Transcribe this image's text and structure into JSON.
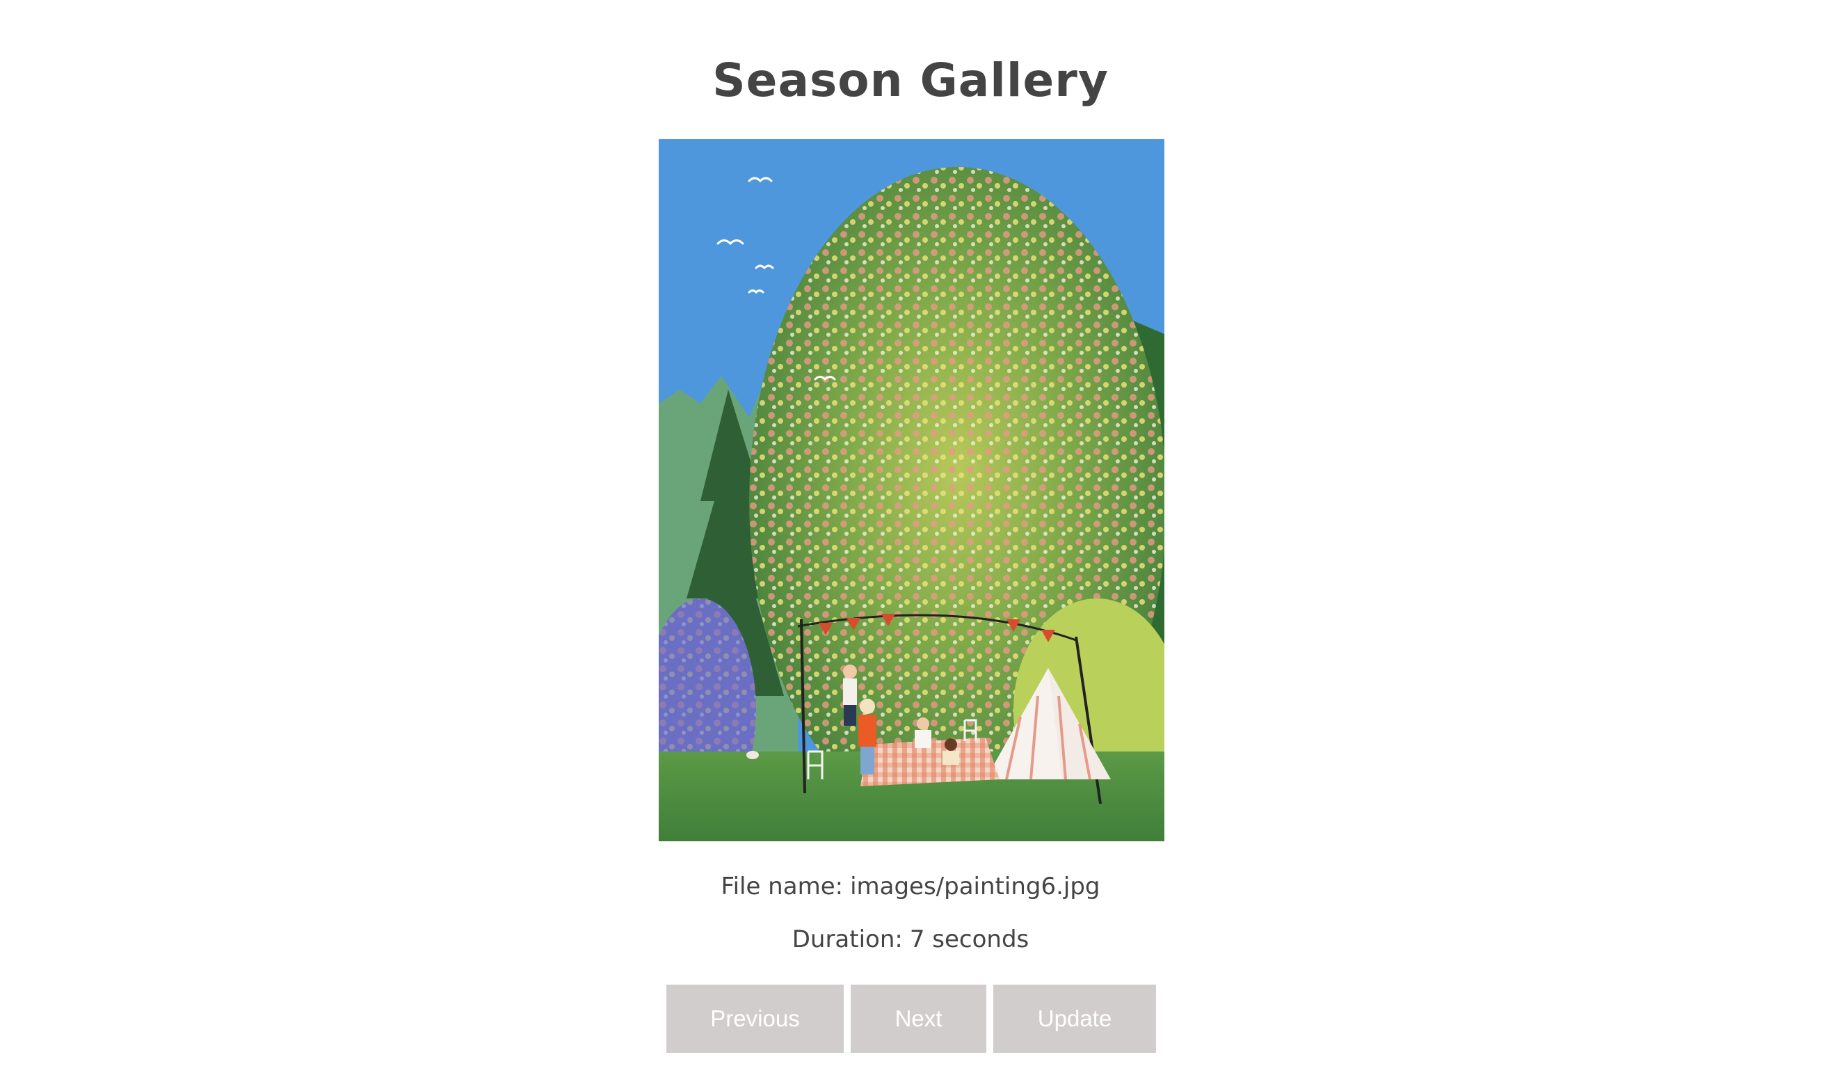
{
  "page": {
    "title": "Season Gallery"
  },
  "image": {
    "description_icon": "painting-image",
    "alt": "images/painting6.jpg"
  },
  "info": {
    "file_name_label": "File name:",
    "file_name_value": "images/painting6.jpg",
    "duration_label": "Duration:",
    "duration_value": "7 seconds"
  },
  "controls": {
    "previous_label": "Previous",
    "next_label": "Next",
    "update_label": "Update"
  },
  "colors": {
    "text": "#444444",
    "button_bg": "#d1cdcd",
    "button_text": "#ffffff",
    "sky": "#4f97dc",
    "foliage": "#5f9a3f",
    "grass": "#4f8a3c"
  }
}
